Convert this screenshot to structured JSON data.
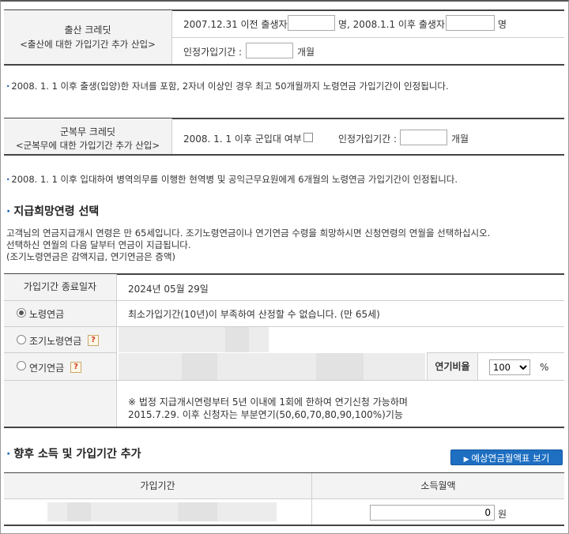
{
  "birth_credit": {
    "title": "출산 크레딧",
    "subtitle": "<출산에 대한 가입기간 추가 산입>",
    "before_label": "2007.12.31 이전 출생자 :",
    "unit_person1": "명, 2008.1.1 이후 출생자 :",
    "unit_person2": "명",
    "period_label": "인정가입기간 :",
    "unit_month": "개월",
    "before_value": "",
    "after_value": "",
    "period_value": "",
    "note": "2008. 1. 1 이후 출생(입양)한 자녀를 포함, 2자녀 이상인 경우 최고 50개월까지 노령연금 가입기간이 인정됩니다."
  },
  "military_credit": {
    "title": "군복무 크레딧",
    "subtitle": "<군복무에 대한 가입기간 추가 산입>",
    "enlist_label": "2008. 1. 1 이후 군입대 여부 :",
    "period_label": "인정가입기간 :",
    "unit_month": "개월",
    "period_value": "",
    "note": "2008. 1. 1 이후 입대하여 병역의무를 이행한 현역병 및 공익근무요원에게 6개월의 노령연금 가입기간이 인정됩니다."
  },
  "pension_age": {
    "section_title": "지급희망연령 선택",
    "desc_line1": "고객님의 연금지급개시 연령은 만 65세입니다. 조기노령연금이나 연기연금 수령을 희망하시면 신청연령의 연월을 선택하십시오.",
    "desc_line2": "선택하신 연월의 다음 달부터 연금이 지급됩니다.",
    "desc_line3": "(조기노령연금은 감액지급, 연기연금은 증액)",
    "end_date_label": "가입기간 종료일자",
    "end_date_value": "2024년 05월 29일",
    "options": [
      {
        "label": "노령연금",
        "checked": true,
        "help": false,
        "text": "최소가입기간(10년)이 부족하여 산정할 수 없습니다. (만 65세)"
      },
      {
        "label": "조기노령연금",
        "checked": false,
        "help": true,
        "text": ""
      },
      {
        "label": "연기연금",
        "checked": false,
        "help": true,
        "text": ""
      }
    ],
    "help_glyph": "?",
    "defer_ratio_label": "연기비율",
    "defer_ratio_value": "100",
    "percent": "%",
    "legal_line1": "※ 법정 지급개시연령부터 5년 이내에 1회에 한하여 연기신청 가능하며",
    "legal_line2": "2015.7.29. 이후 신청자는 부분연기(50,60,70,80,90,100%)기능"
  },
  "future": {
    "section_title": "향후 소득 및 가입기간 추가",
    "button_label": "예상연금월액표 보기",
    "col_period": "가입기간",
    "col_income": "소득월액",
    "income_value": "0",
    "unit_won": "원"
  },
  "colors": {
    "accent": "#1e6fc2",
    "header_bg": "#f3f3f3"
  }
}
